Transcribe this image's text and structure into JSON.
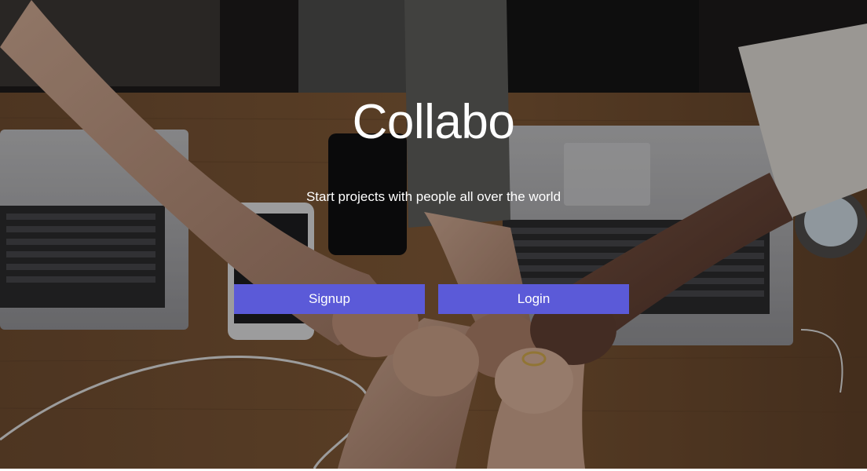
{
  "hero": {
    "title": "Collabo",
    "tagline": "Start projects with people all over the world",
    "background_image": "team-fist-bump-over-laptops"
  },
  "actions": {
    "signup_label": "Signup",
    "login_label": "Login"
  },
  "colors": {
    "accent": "#5b5ad8",
    "text": "#ffffff",
    "overlay": "rgba(0,0,0,0.28)"
  }
}
